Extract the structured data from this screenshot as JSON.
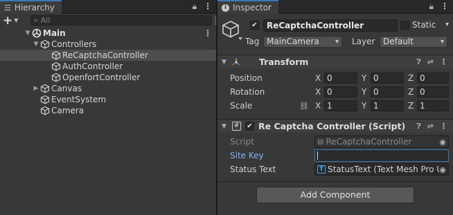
{
  "hierarchy": {
    "tab_label": "Hierarchy",
    "search_placeholder": "All",
    "add_label": "+",
    "tree": [
      {
        "label": "Main"
      },
      {
        "label": "Controllers"
      },
      {
        "label": "ReCaptchaController"
      },
      {
        "label": "AuthController"
      },
      {
        "label": "OpenfortController"
      },
      {
        "label": "Canvas"
      },
      {
        "label": "EventSystem"
      },
      {
        "label": "Camera"
      }
    ]
  },
  "inspector": {
    "tab_label": "Inspector",
    "object_name": "ReCaptchaController",
    "static_label": "Static",
    "tag_label": "Tag",
    "tag_value": "MainCamera",
    "layer_label": "Layer",
    "layer_value": "Default",
    "transform": {
      "title": "Transform",
      "position_label": "Position",
      "rotation_label": "Rotation",
      "scale_label": "Scale",
      "x": "X",
      "y": "Y",
      "z": "Z",
      "position": [
        "0",
        "0",
        "0"
      ],
      "rotation": [
        "0",
        "0",
        "0"
      ],
      "scale": [
        "1",
        "1",
        "1"
      ]
    },
    "script_component": {
      "title": "Re Captcha Controller (Script)",
      "script_label": "Script",
      "script_value": "ReCaptchaController",
      "site_key_label": "Site Key",
      "site_key_value": "",
      "status_text_label": "Status Text",
      "status_text_value": "StatusText (Text Mesh Pro U"
    },
    "add_component_label": "Add Component"
  },
  "colors": {
    "panel_bg": "#383838",
    "accent": "#3a79bb",
    "selection": "#4d4d4d",
    "label_blue": "#7fb4f0"
  }
}
